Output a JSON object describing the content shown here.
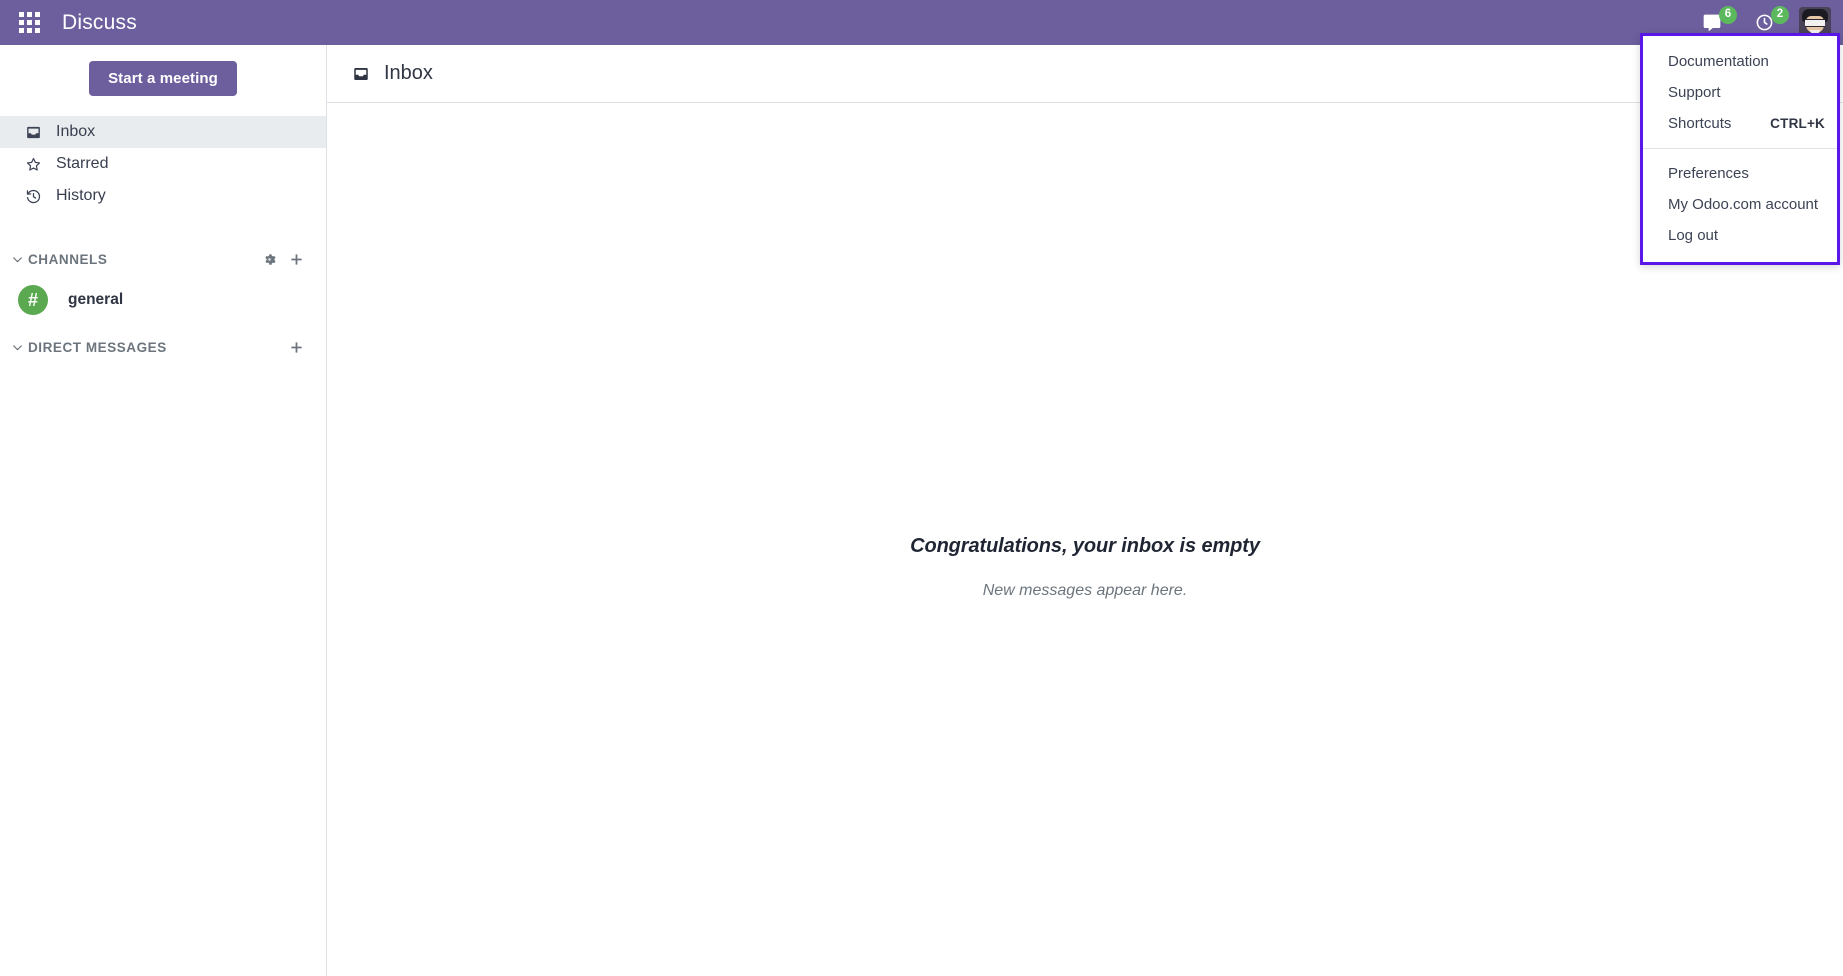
{
  "topbar": {
    "apps_icon": "grid-apps-icon",
    "title": "Discuss",
    "systray": [
      {
        "icon": "messages-bubble-icon",
        "badge": "6",
        "name": "messaging-menu"
      },
      {
        "icon": "activity-clock-icon",
        "badge": "2",
        "name": "activity-menu"
      }
    ],
    "avatar_alt": "user-avatar"
  },
  "sidebar": {
    "start_meeting_label": "Start a meeting",
    "nav": [
      {
        "label": "Inbox",
        "icon": "inbox-icon",
        "active": true
      },
      {
        "label": "Starred",
        "icon": "star-icon",
        "active": false
      },
      {
        "label": "History",
        "icon": "history-icon",
        "active": false
      }
    ],
    "channels_section": {
      "title": "CHANNELS",
      "chevron": "chevron-down-icon",
      "gear": "gear-icon",
      "plus": "plus-icon",
      "items": [
        {
          "name": "general",
          "avatar_glyph": "#",
          "avatar_color": "#5aa84f"
        }
      ]
    },
    "direct_messages_section": {
      "title": "DIRECT MESSAGES",
      "chevron": "chevron-down-icon",
      "plus": "plus-icon",
      "items": []
    }
  },
  "main": {
    "header": {
      "icon": "inbox-icon",
      "title": "Inbox"
    },
    "empty_state": {
      "title": "Congratulations, your inbox is empty",
      "subtitle": "New messages appear here."
    }
  },
  "user_dropdown": {
    "highlight_color": "#5b16e8",
    "groups": [
      {
        "items": [
          {
            "label": "Documentation",
            "shortcut": ""
          },
          {
            "label": "Support",
            "shortcut": ""
          },
          {
            "label": "Shortcuts",
            "shortcut": "CTRL+K"
          }
        ]
      },
      {
        "items": [
          {
            "label": "Preferences",
            "shortcut": ""
          },
          {
            "label": "My Odoo.com account",
            "shortcut": ""
          },
          {
            "label": "Log out",
            "shortcut": ""
          }
        ]
      }
    ]
  },
  "colors": {
    "brand_purple": "#6d5f9e",
    "badge_green": "#5cb85c",
    "active_row": "#e9ecef",
    "border": "#dee2e6",
    "highlight": "#5b16e8"
  }
}
